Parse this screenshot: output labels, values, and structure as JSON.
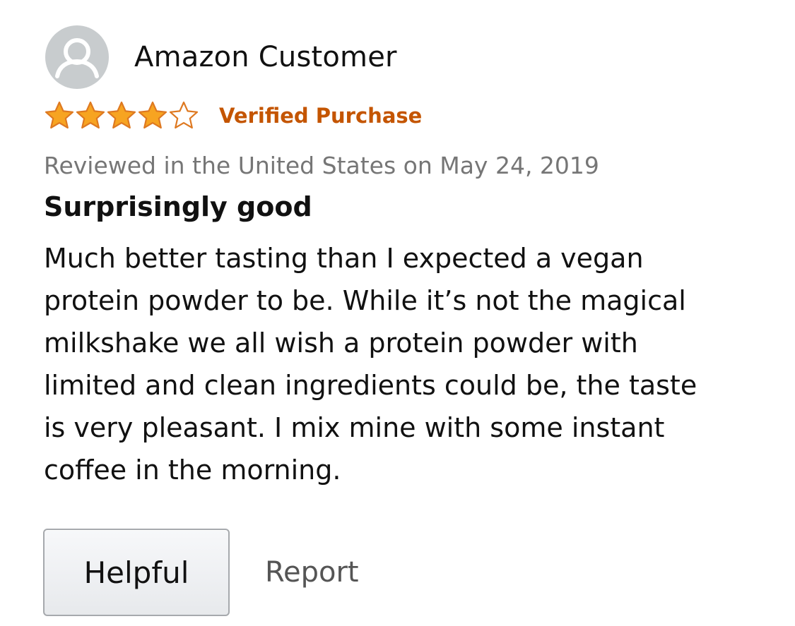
{
  "review": {
    "author": "Amazon Customer",
    "rating": {
      "value": 4,
      "max": 5
    },
    "verified_label": "Verified Purchase",
    "date_line": "Reviewed in the United States on May 24, 2019",
    "title": "Surprisingly good",
    "body_lines": [
      "Much better tasting than I expected a vegan",
      "protein powder to be. While it’s not the magical",
      "milkshake we all wish a protein powder with",
      "limited and clean ingredients could be, the taste",
      "is very pleasant. I mix mine with some instant",
      "coffee in the morning."
    ],
    "helpful_label": "Helpful",
    "report_label": "Report"
  },
  "icons": {
    "avatar": "user-silhouette-icon",
    "star_filled": "star-filled-icon",
    "star_empty": "star-outline-icon"
  },
  "colors": {
    "star_fill": "#f7a421",
    "star_stroke": "#de7921",
    "verified": "#c45500",
    "date": "#767676",
    "avatar_bg": "#c8ccce"
  }
}
